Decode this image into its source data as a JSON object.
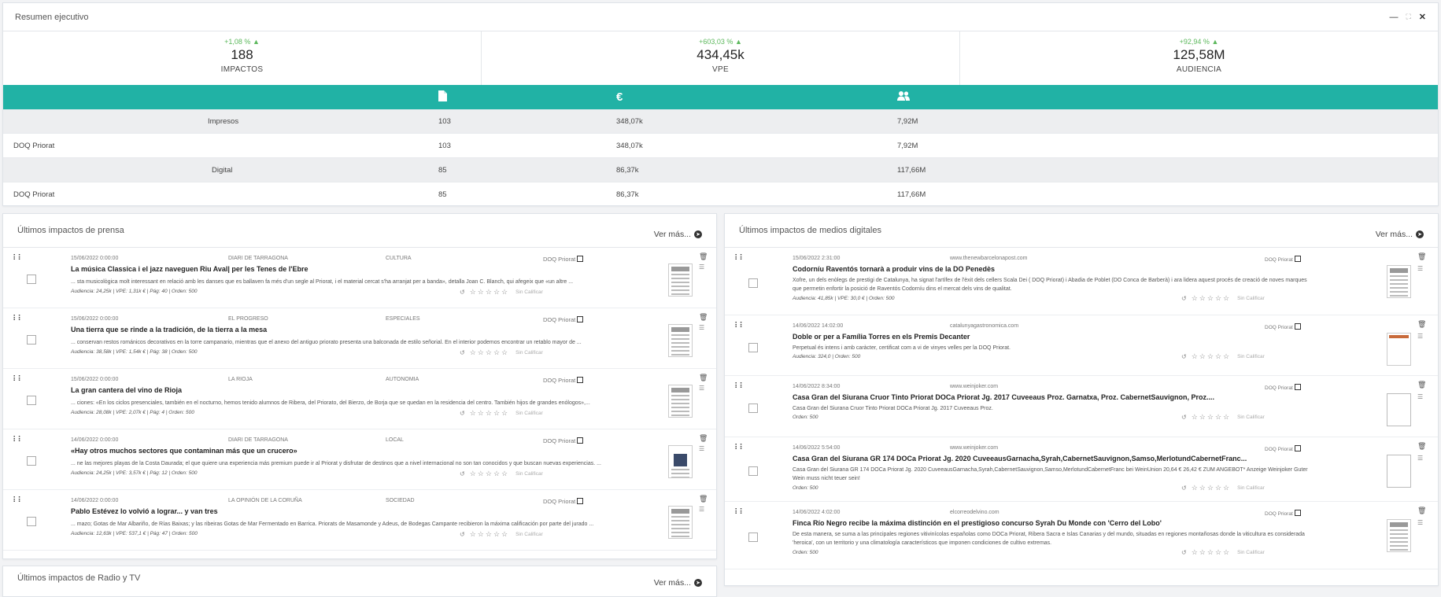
{
  "summary": {
    "title": "Resumen ejecutivo",
    "kpis": [
      {
        "change": "+1,08 %",
        "value": "188",
        "label": "IMPACTOS"
      },
      {
        "change": "+603,03 %",
        "value": "434,45k",
        "label": "VPE"
      },
      {
        "change": "+92,94 %",
        "value": "125,58M",
        "label": "AUDIENCIA"
      }
    ],
    "icons": [
      "document-icon",
      "euro-icon",
      "users-icon"
    ],
    "accent": "#21b2a5",
    "positive_color": "#5cb85c",
    "rows": [
      {
        "name": "Impresos",
        "impacts": "103",
        "vpe": "348,07k",
        "audience": "7,92M"
      },
      {
        "name": "DOQ Priorat",
        "impacts": "103",
        "vpe": "348,07k",
        "audience": "7,92M"
      },
      {
        "name": "Digital",
        "impacts": "85",
        "vpe": "86,37k",
        "audience": "117,66M"
      },
      {
        "name": "DOQ Priorat",
        "impacts": "85",
        "vpe": "86,37k",
        "audience": "117,66M"
      }
    ]
  },
  "press": {
    "title": "Últimos impactos de prensa",
    "more": "Ver más...",
    "items": [
      {
        "date": "15/06/2022 0:00:00",
        "source": "DIARI DE TARRAGONA",
        "section": "CULTURA",
        "client": "DOQ Priorat",
        "title": "La música Classica i el jazz naveguen Riu Aval| per les Tenes de l'Ebre",
        "snippet": "... sta musicològica molt interessant en relació amb les danses que es ballaven fa més d'un segle al Priorat, i el material cercat s'ha arranjat per a banda», detalla Joan C. Blanch, qui afegeix que «un altre ...",
        "meta": "Audiencia: 24,25k | VPE: 1,31k € | Pág: 40 | Orden: 500",
        "rate": "Sin Calificar"
      },
      {
        "date": "15/06/2022 0:00:00",
        "source": "EL PROGRESO",
        "section": "ESPECIALES",
        "client": "DOQ Priorat",
        "title": "Una tierra que se rinde a la tradición, de la tierra a la mesa",
        "snippet": "... conservan restos románicos decorativos en la torre campanario, mientras que el anexo del antiguo priorato presenta una balconada de estilo señorial. En el interior podemos encontrar un retablo mayor de ...",
        "meta": "Audiencia: 38,58k | VPE: 1,54k € | Pág: 38 | Orden: 500",
        "rate": "Sin Calificar"
      },
      {
        "date": "15/06/2022 0:00:00",
        "source": "LA RIOJA",
        "section": "AUTONOMIA",
        "client": "DOQ Priorat",
        "title": "La gran cantera del vino de Rioja",
        "snippet": "... ciones: «En los ciclos presenciales, también en el nocturno, hemos tenido alumnos de Ribera, del Priorato, del Bierzo, de Borja que se quedan en la residencia del centro. También hijos de grandes enólogos»,...",
        "meta": "Audiencia: 28,08k | VPE: 2,07k € | Pág: 4 | Orden: 500",
        "rate": "Sin Calificar"
      },
      {
        "date": "14/06/2022 0:00:00",
        "source": "DIARI DE TARRAGONA",
        "section": "LOCAL",
        "client": "DOQ Priorat",
        "title": "«Hay otros muchos sectores que contaminan más que un crucero»",
        "snippet": "... ne las mejores playas de la Costa Daurada; el que quiere una experiencia más premium puede ir al Priorat y disfrutar de destinos que a nivel internacional no son tan conocidos y que buscan nuevas experiencias. ...",
        "meta": "Audiencia: 24,25k | VPE: 3,57k € | Pág: 12 | Orden: 500",
        "rate": "Sin Calificar"
      },
      {
        "date": "14/06/2022 0:00:00",
        "source": "LA OPINIÓN DE LA CORUÑA",
        "section": "SOCIEDAD",
        "client": "DOQ Priorat",
        "title": "Pablo Estévez lo volvió a lograr... y van tres",
        "snippet": "... mazo; Gotas de Mar Albariño, de Rías Baixas; y las ribeiras Gotas de Mar Fermentado en Barrica. Priorats de Masamonde y Adeus, de Bodegas Campante recibieron la máxima calificación por parte del jurado ...",
        "meta": "Audiencia: 12,63k | VPE: 537,1 € | Pág: 47 | Orden: 500",
        "rate": "Sin Calificar"
      }
    ]
  },
  "digital": {
    "title": "Últimos impactos de medios digitales",
    "more": "Ver más...",
    "items": [
      {
        "date": "15/06/2022 2:31:00",
        "source": "www.thenewbarcelonapost.com",
        "client": "DOQ Priorat",
        "title": "Codorníu Raventós tornarà a produir vins de la DO Penedès",
        "snippet": "Xofre, un dels enòlegs de prestigi de Catalunya, ha signat l'artífex de l'èxit dels cellers Scala Dei ( DOQ Priorat) i Abadia de Poblet (DO Conca de Barberà) i ara lidera aquest procés de creació de noves marques que permetin enfortir la posició de Raventós Codorníu dins el mercat dels vins de qualitat.",
        "meta": "Audiencia: 41,85k | VPE: 30,0 € | Orden: 500",
        "rate": "Sin Calificar"
      },
      {
        "date": "14/06/2022 14:02:00",
        "source": "catalunyagastronomica.com",
        "client": "DOQ Priorat",
        "title": "Doble or per a Família Torres en els Premis Decanter",
        "snippet": "Perpetual és intens i amb caràcter, certificat com a vi de vinyes velles per la DOQ Priorat.",
        "meta": "Audiencia: 324,0 | Orden: 500",
        "rate": "Sin Calificar"
      },
      {
        "date": "14/06/2022 8:34:00",
        "source": "www.weinjoker.com",
        "client": "DOQ Priorat",
        "title": "Casa Gran del Siurana Cruor Tinto Priorat DOCa Priorat Jg. 2017 Cuveeaus Proz. Garnatxa, Proz. CabernetSauvignon, Proz....",
        "snippet": "Casa Gran del Siurana Cruor Tinto Priorat DOCa Priorat Jg. 2017 Cuveeaus Proz.",
        "meta": "Orden: 500",
        "rate": "Sin Calificar"
      },
      {
        "date": "14/06/2022 5:54:00",
        "source": "www.weinjoker.com",
        "client": "DOQ Priorat",
        "title": "Casa Gran del Siurana GR 174 DOCa Priorat Jg. 2020 CuveeausGarnacha,Syrah,CabernetSauvignon,Samso,MerlotundCabernetFranc...",
        "snippet": "Casa Gran del Siurana GR 174 DOCa Priorat Jg. 2020 CuveeausGarnacha,Syrah,CabernetSauvignon,Samso,MerlotundCabernetFranc bei WeinUnion 20,64 € 26,42 € ZUM ANGEBOT* Anzeige Weinjoker Guter Wein muss nicht teuer sein!",
        "meta": "Orden: 500",
        "rate": "Sin Calificar"
      },
      {
        "date": "14/06/2022 4:02:00",
        "source": "elcorreodelvino.com",
        "client": "DOQ Priorat",
        "title": "Finca Río Negro recibe la máxima distinción en el prestigioso concurso Syrah Du Monde con 'Cerro del Lobo'",
        "snippet": "De esta manera, se suma a las principales regiones vitivinícolas españolas como DOCa Priorat, Ribera Sacra e Islas Canarias y del mundo, situadas en regiones montañosas donde la viticultura es considerada 'heroica', con un territorio y una climatología característicos que imponen condiciones de cultivo extremas.",
        "meta": "Orden: 500",
        "rate": "Sin Calificar"
      }
    ]
  },
  "radio": {
    "title": "Últimos impactos de Radio y TV",
    "more": "Ver más..."
  }
}
